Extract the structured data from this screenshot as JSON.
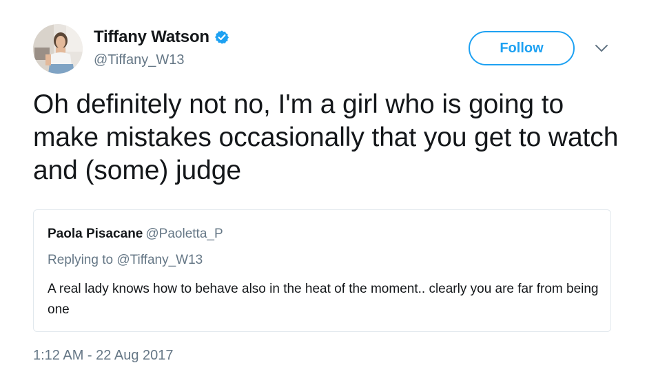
{
  "author": {
    "display_name": "Tiffany Watson",
    "username": "@Tiffany_W13",
    "verified": true,
    "avatar_icon": "profile-photo"
  },
  "actions": {
    "follow_label": "Follow",
    "more_icon": "chevron-down-icon"
  },
  "tweet": {
    "text": "Oh definitely not no, I'm a girl who is going to make mistakes occasionally that you get to watch and (some) judge",
    "timestamp": "1:12 AM - 22 Aug 2017"
  },
  "quoted_tweet": {
    "display_name": "Paola Pisacane",
    "username": "@Paoletta_P",
    "reply_context": "Replying to @Tiffany_W13",
    "text": "A real lady knows how to behave also in the heat of the moment.. clearly you are far from being one"
  },
  "colors": {
    "accent": "#1da1f2",
    "secondary_text": "#657786",
    "primary_text": "#14171a",
    "card_border": "#e1e8ed"
  }
}
